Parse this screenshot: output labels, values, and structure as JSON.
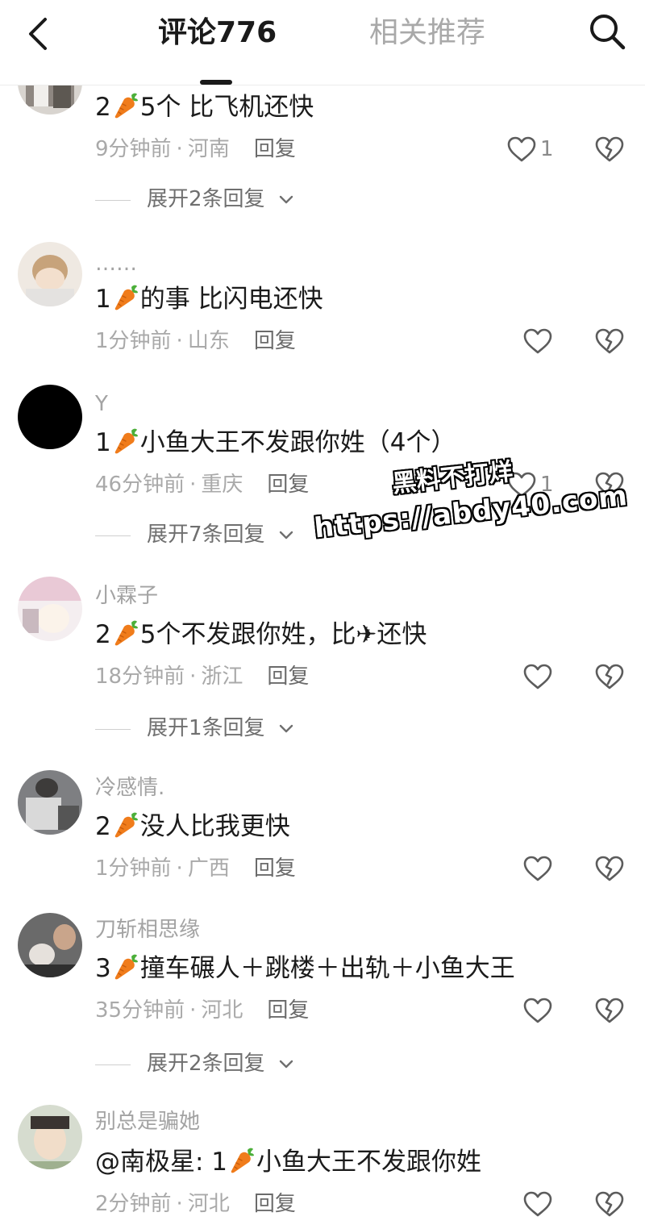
{
  "header": {
    "tab_comments": "评论776",
    "tab_recommend": "相关推荐"
  },
  "comments": [
    {
      "username": "",
      "content_before": "2",
      "content_after": "5个 比飞机还快",
      "time": "9分钟前",
      "location": "河南",
      "reply": "回复",
      "likes": "1",
      "expand": "展开2条回复"
    },
    {
      "username": "……",
      "content_before": "1",
      "content_after": "的事 比闪电还快",
      "time": "1分钟前",
      "location": "山东",
      "reply": "回复",
      "likes": "",
      "expand": ""
    },
    {
      "username": "Y",
      "content_before": "1",
      "content_after": "小鱼大王不发跟你姓（4个）",
      "time": "46分钟前",
      "location": "重庆",
      "reply": "回复",
      "likes": "1",
      "expand": "展开7条回复"
    },
    {
      "username": "小霖子",
      "content_before": "2",
      "content_after": "5个不发跟你姓，比✈还快",
      "time": "18分钟前",
      "location": "浙江",
      "reply": "回复",
      "likes": "",
      "expand": "展开1条回复"
    },
    {
      "username": "冷感情.",
      "content_before": "2",
      "content_after": "没人比我更快",
      "time": "1分钟前",
      "location": "广西",
      "reply": "回复",
      "likes": "",
      "expand": ""
    },
    {
      "username": "刀斩相思缘",
      "content_before": "3",
      "content_after": "撞车碾人＋跳楼＋出轨＋小鱼大王",
      "time": "35分钟前",
      "location": "河北",
      "reply": "回复",
      "likes": "",
      "expand": "展开2条回复"
    },
    {
      "username": "别总是骗她",
      "content_before": "@南极星: 1",
      "content_after": "小鱼大王不发跟你姓",
      "time": "2分钟前",
      "location": "河北",
      "reply": "回复",
      "likes": "",
      "expand": ""
    }
  ],
  "watermark": {
    "line1": "黑料不打烊",
    "line2": "https://abdy40.com"
  },
  "icons": [
    "back-icon",
    "search-icon",
    "heart-icon",
    "broken-heart-icon",
    "chevron-down-icon",
    "carrot-emoji"
  ],
  "colors": {
    "text_primary": "#1b1b1b",
    "text_secondary": "#a9a9a9",
    "tab_active": "#1a1a1a",
    "tab_inactive": "#a9a9a9",
    "carrot": "#f07c1b"
  }
}
